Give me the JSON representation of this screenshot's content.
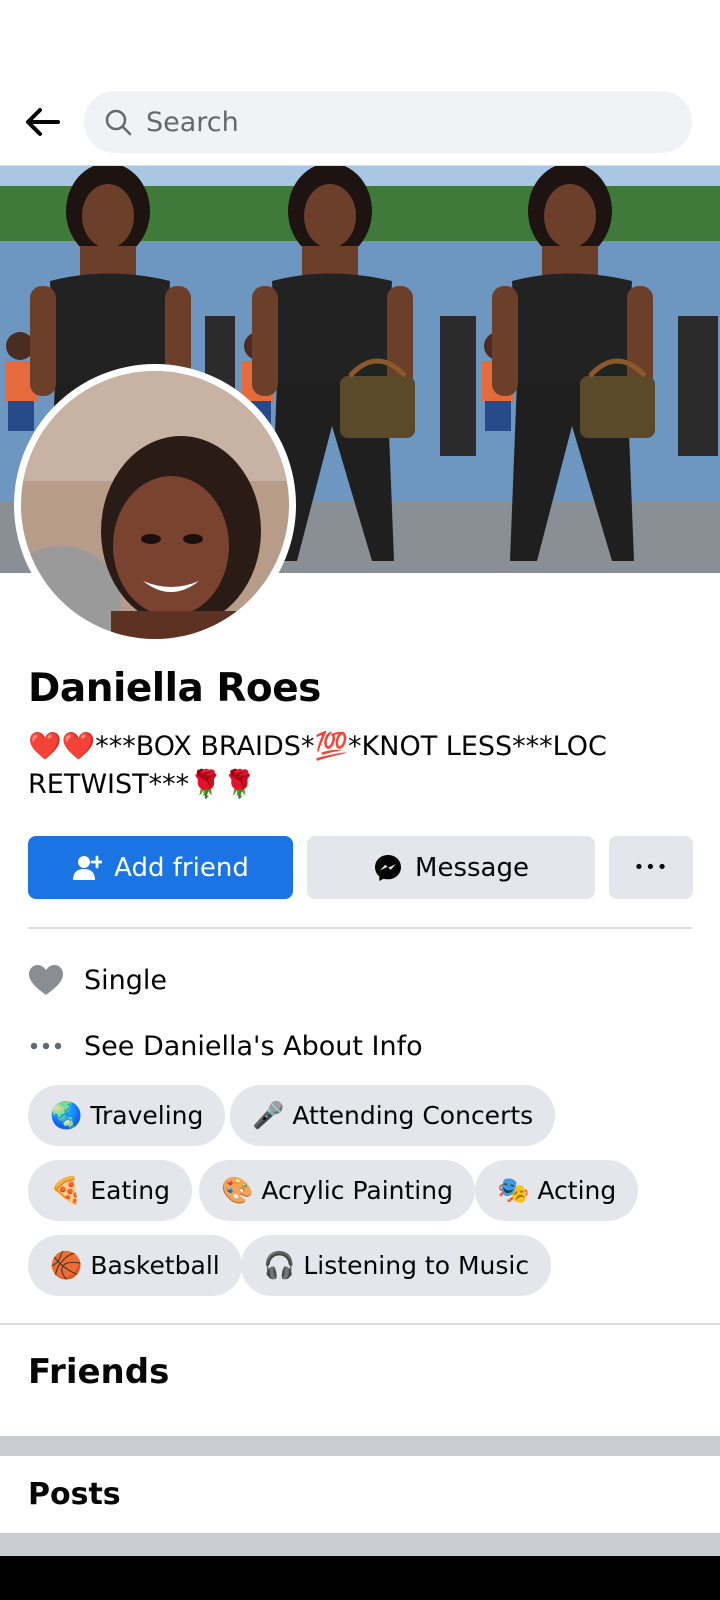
{
  "search": {
    "placeholder": "Search"
  },
  "profile": {
    "name": "Daniella Roes",
    "bio": "❤️❤️***BOX BRAIDS*💯*KNOT LESS***LOC RETWIST***🌹🌹"
  },
  "actions": {
    "add_friend": "Add friend",
    "message": "Message",
    "more": "•••"
  },
  "details": {
    "relationship": "Single",
    "about_link": "See Daniella's About Info"
  },
  "hobbies": [
    {
      "emoji": "🌏",
      "label": "Traveling"
    },
    {
      "emoji": "🎤",
      "label": "Attending Concerts"
    },
    {
      "emoji": "🍕",
      "label": "Eating"
    },
    {
      "emoji": "🎨",
      "label": "Acrylic Painting"
    },
    {
      "emoji": "🎭",
      "label": "Acting"
    },
    {
      "emoji": "🏀",
      "label": "Basketball"
    },
    {
      "emoji": "🎧",
      "label": "Listening to Music"
    }
  ],
  "sections": {
    "friends": "Friends",
    "posts": "Posts"
  },
  "colors": {
    "primary": "#1b74e4",
    "button_gray": "#e4e6eb",
    "search_bg": "#f0f2f5",
    "divider": "#dadde1"
  }
}
